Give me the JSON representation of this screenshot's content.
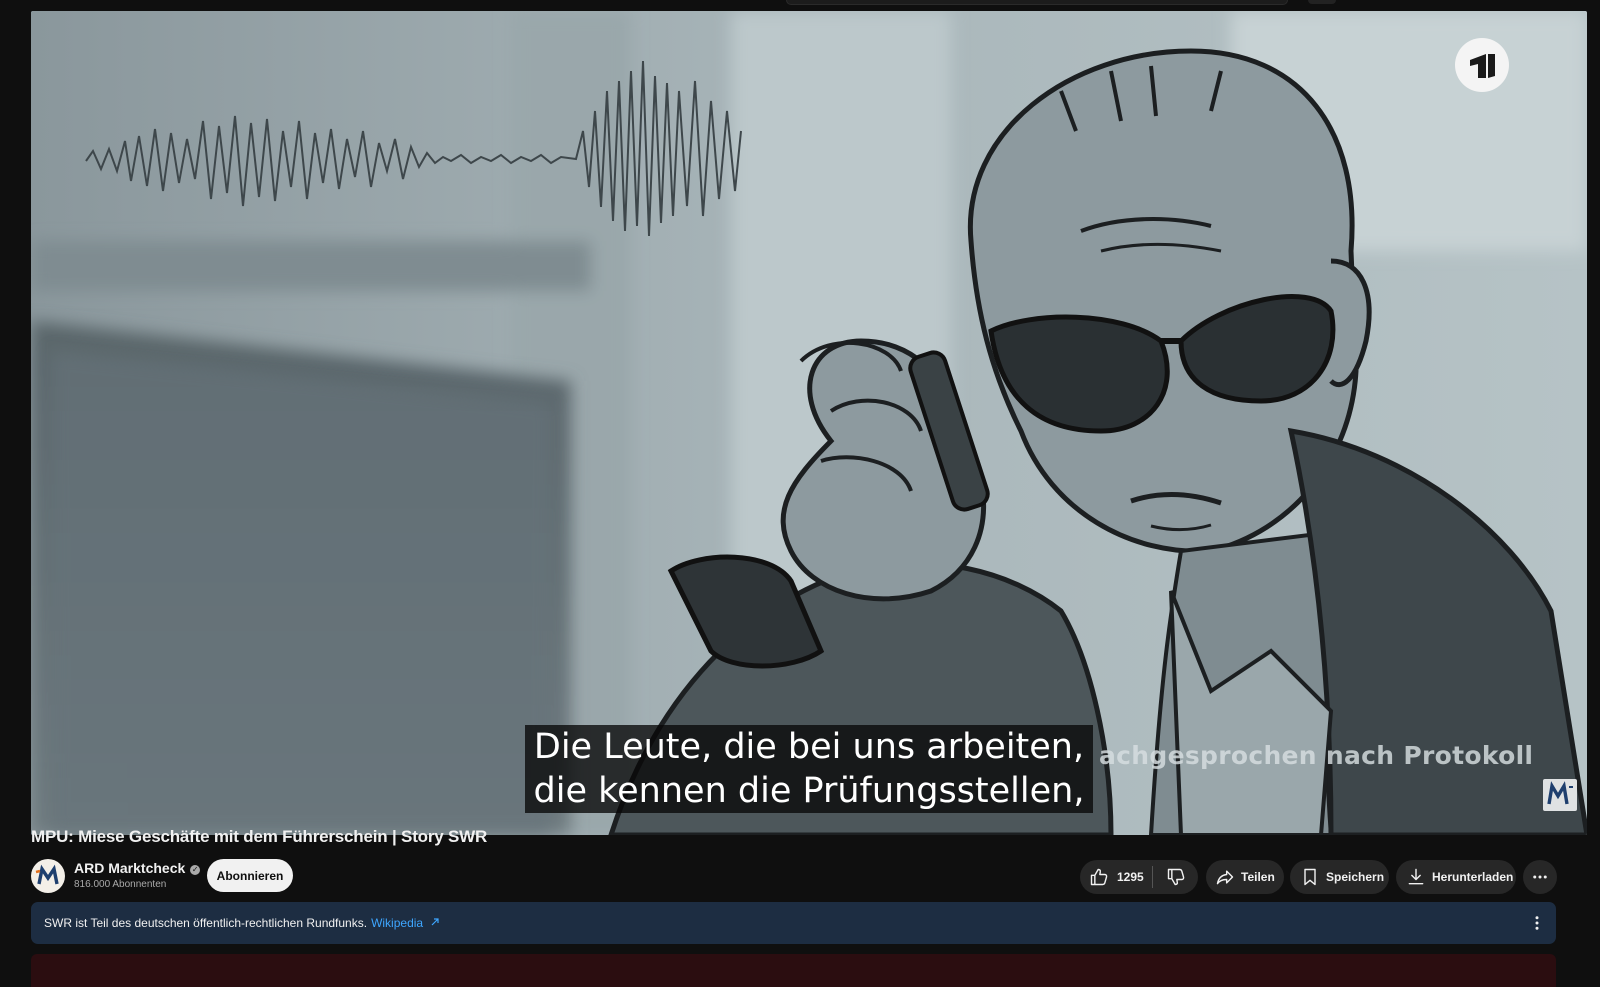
{
  "video": {
    "title": "MPU: Miese Geschäfte mit dem Führerschein | Story SWR",
    "captions": [
      "Die Leute, die bei uns arbeiten,",
      "die kennen die Prüfungsstellen,"
    ],
    "overlay_text": "nachgesprochen nach Protokoll",
    "overlay_visible": "achgesprochen nach Protokoll"
  },
  "channel": {
    "name": "ARD Marktcheck",
    "subscribers": "816.000 Abonnenten",
    "subscribe_label": "Abonnieren",
    "avatar_letters": "M"
  },
  "actions": {
    "likes": "1295",
    "share_label": "Teilen",
    "save_label": "Speichern",
    "download_label": "Herunterladen"
  },
  "info": {
    "text": "SWR ist Teil des deutschen öffentlich-rechtlichen Rundfunks.",
    "link": "Wikipedia"
  },
  "icons": [
    "ard-one-logo-icon",
    "marktcheck-badge-icon",
    "like-icon",
    "dislike-icon",
    "share-icon",
    "save-icon",
    "download-icon",
    "more-icon",
    "external-link-icon",
    "verified-icon"
  ],
  "colors": {
    "background": "#0f0f0f",
    "pill": "#272727",
    "info_bar": "#1d2d42",
    "link": "#3ea6ff"
  }
}
